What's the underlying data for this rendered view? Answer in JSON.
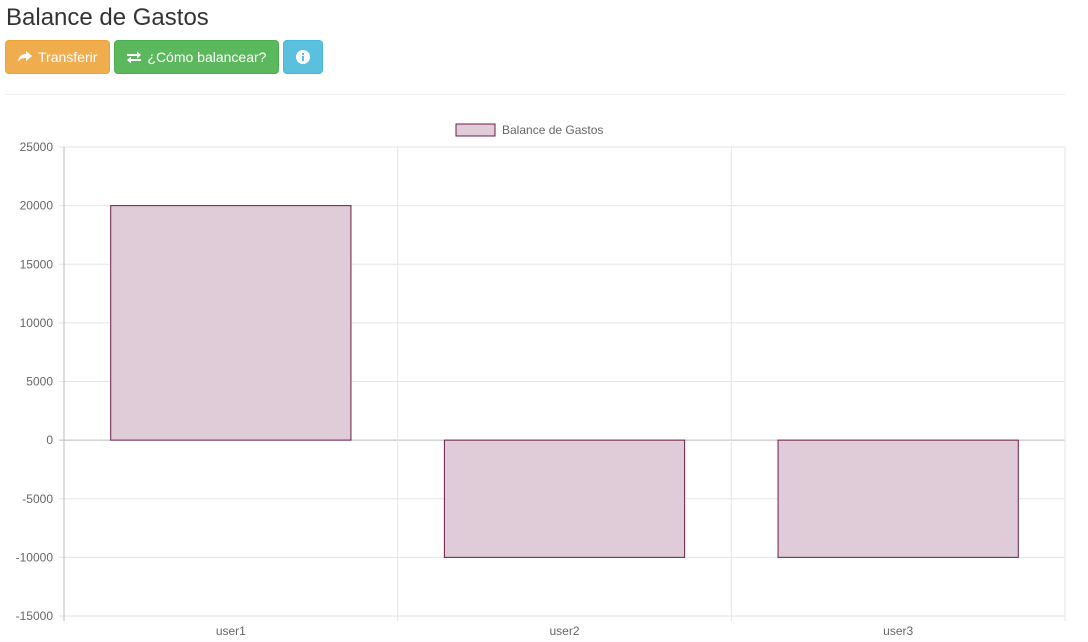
{
  "header": {
    "title": "Balance de Gastos"
  },
  "toolbar": {
    "transfer_label": "Transferir",
    "balance_label": "¿Cómo balancear?",
    "colors": {
      "warning": "#f0ad4e",
      "success": "#5cb85c",
      "info": "#5bc0de"
    },
    "icons": {
      "transfer": "share-arrow-icon",
      "balance": "exchange-arrows-icon",
      "info": "info-circle-icon"
    }
  },
  "chart_data": {
    "type": "bar",
    "categories": [
      "user1",
      "user2",
      "user3"
    ],
    "series": [
      {
        "name": "Balance de Gastos",
        "values": [
          20000,
          -10000,
          -10000
        ]
      }
    ],
    "ylim": [
      -15000,
      25000
    ],
    "yticks": [
      25000,
      20000,
      15000,
      10000,
      5000,
      0,
      -5000,
      -10000,
      -15000
    ],
    "grid": true,
    "legend_position": "top-center",
    "bar_fill": "#e0ccd8",
    "bar_stroke": "#6b1d48"
  }
}
